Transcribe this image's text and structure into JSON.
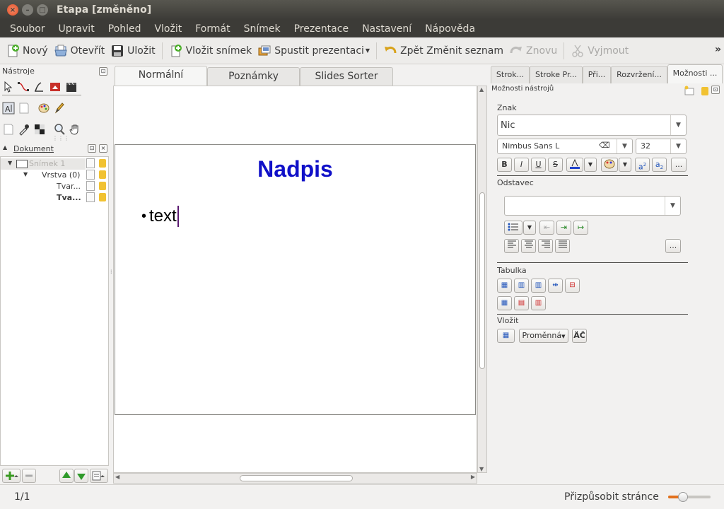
{
  "window": {
    "title": "Etapa [změněno]"
  },
  "menu": [
    "Soubor",
    "Upravit",
    "Pohled",
    "Vložit",
    "Formát",
    "Snímek",
    "Prezentace",
    "Nastavení",
    "Nápověda"
  ],
  "toolbar": {
    "new": "Nový",
    "open": "Otevřít",
    "save": "Uložit",
    "insert_slide": "Vložit snímek",
    "start_presentation": "Spustit prezentaci",
    "undo": "Zpět Změnit seznam",
    "redo": "Znovu",
    "cut": "Vyjmout",
    "more": "»"
  },
  "left_panel": {
    "tools_title": "Nástroje",
    "document_title": "Dokument",
    "tree": [
      {
        "label": "Snímek 1"
      },
      {
        "label": "Vrstva (0)"
      },
      {
        "label": "Tvar..."
      },
      {
        "label": "Tva..."
      }
    ]
  },
  "view_tabs": [
    "Normální",
    "Poznámky",
    "Slides Sorter"
  ],
  "slide": {
    "title": "Nadpis",
    "bullet": "•",
    "body": "text",
    "title_color": "#1010c8"
  },
  "right_panel": {
    "tabs": [
      "Strok...",
      "Stroke Pr...",
      "Při...",
      "Rozvržení...",
      "Možnosti ..."
    ],
    "panel_title": "Možnosti nástrojů",
    "char_section": "Znak",
    "style_value": "Nic",
    "font_value": "Nimbus Sans L",
    "size_value": "32",
    "paragraph_section": "Odstavec",
    "paragraph_value": "",
    "table_section": "Tabulka",
    "insert_section": "Vložit",
    "variable_label": "Proměnná",
    "more_label": "..."
  },
  "status": {
    "page": "1/1",
    "zoom_label": "Přizpůsobit stránce",
    "zoom_level": 0.35
  }
}
